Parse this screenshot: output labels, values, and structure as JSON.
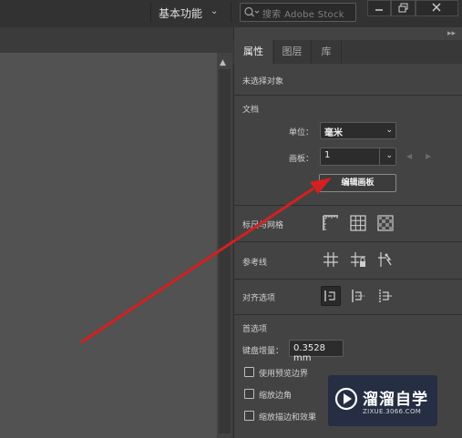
{
  "topbar": {
    "workspace_label": "基本功能",
    "search_placeholder": "搜索 Adobe Stock"
  },
  "panel": {
    "tabs": [
      "属性",
      "图层",
      "库"
    ],
    "active_tab": "属性",
    "no_selection": "未选择对象",
    "document": {
      "heading": "文档",
      "unit_label": "单位：",
      "unit_value": "毫米",
      "artboard_label": "画板：",
      "artboard_value": "1",
      "edit_button": "编辑画板"
    },
    "rulers_grids": "标尺与网格",
    "guides": "参考线",
    "align_options": "对齐选项",
    "preferences": {
      "heading": "首选项",
      "keyboard_increment_label": "键盘增量：",
      "keyboard_increment_value": "0.3528 mm",
      "use_preview_bounds": "使用预览边界",
      "scale_corners": "缩放边角",
      "scale_strokes_effects": "缩放描边和效果"
    }
  },
  "watermark": {
    "title": "溜溜自学",
    "url": "ZIXUE.3066.COM"
  },
  "colors": {
    "panel_bg": "#434343",
    "canvas_bg": "#525252",
    "arrow": "#d42020"
  }
}
